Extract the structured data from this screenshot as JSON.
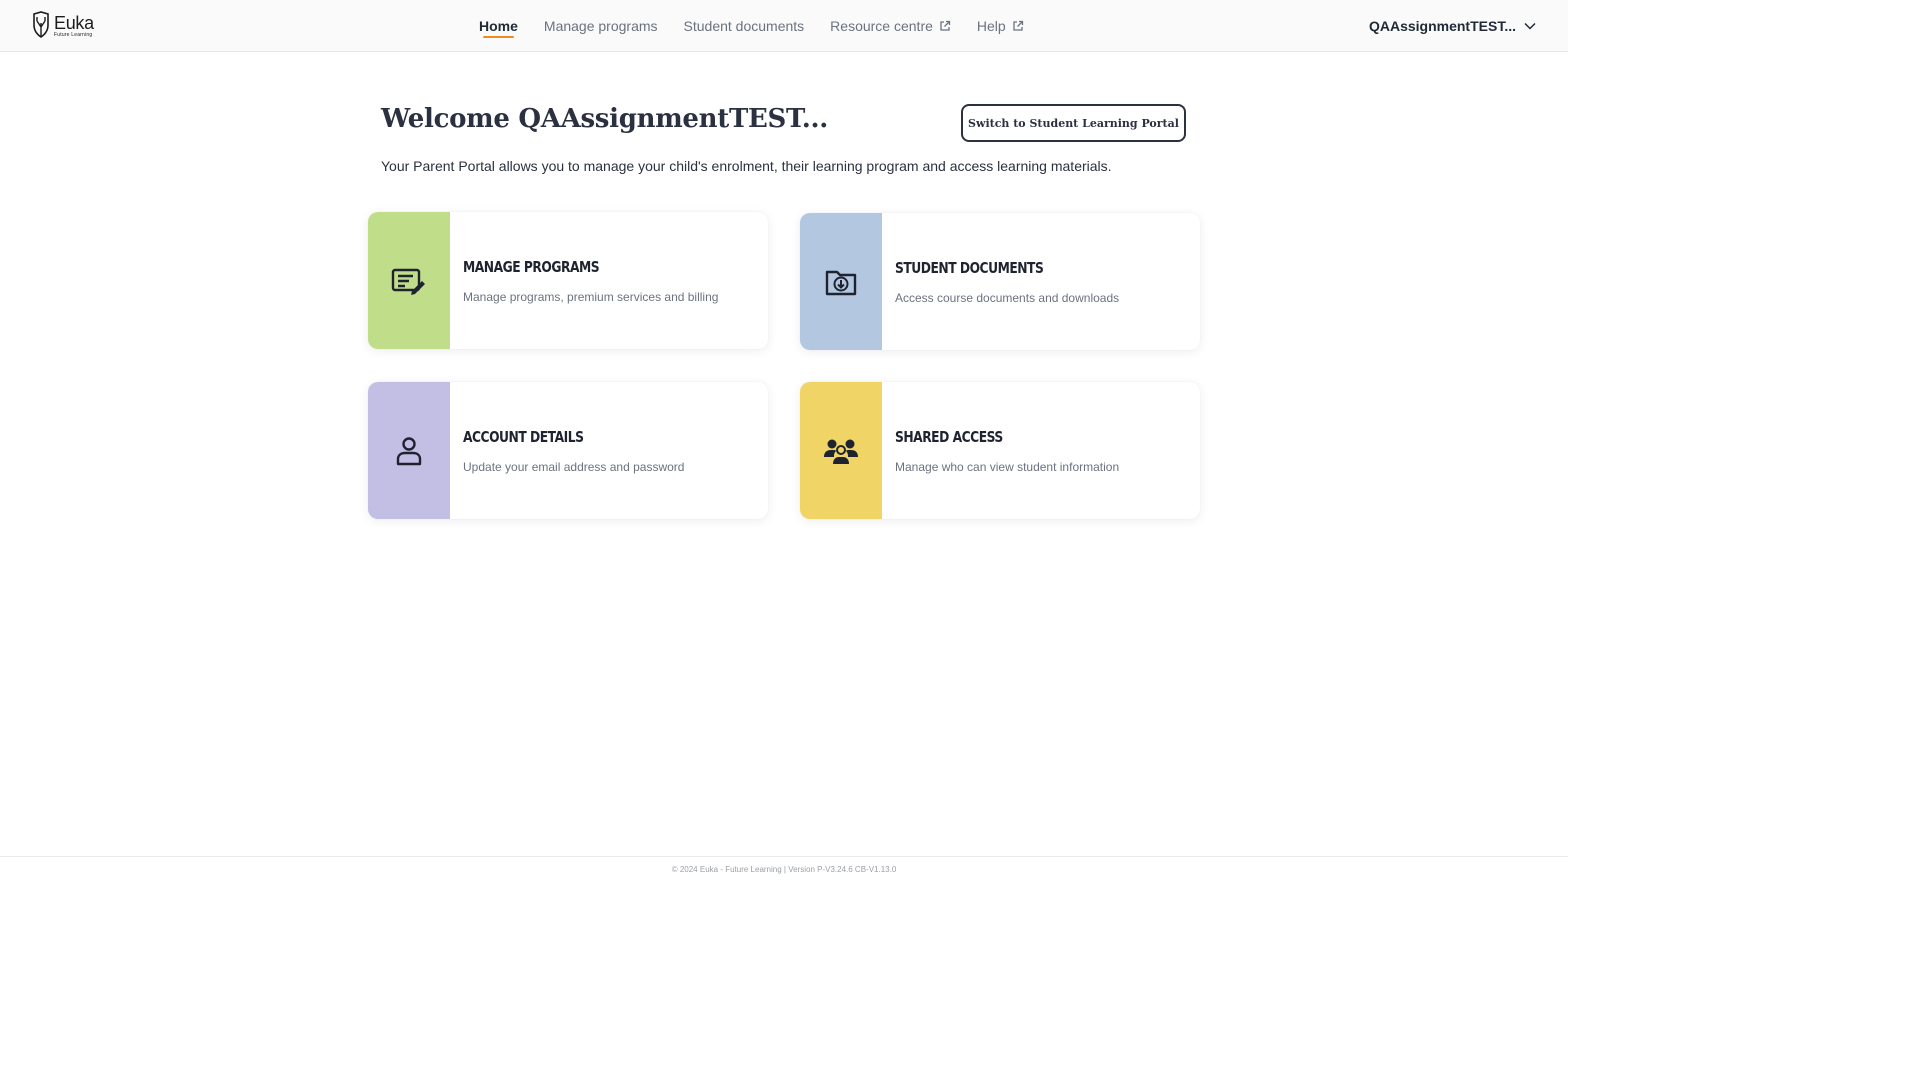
{
  "header": {
    "logo": {
      "name": "Euka",
      "tagline": "Future Learning"
    },
    "nav": [
      {
        "label": "Home",
        "active": true,
        "external": false
      },
      {
        "label": "Manage programs",
        "active": false,
        "external": false
      },
      {
        "label": "Student documents",
        "active": false,
        "external": false
      },
      {
        "label": "Resource centre",
        "active": false,
        "external": true
      },
      {
        "label": "Help",
        "active": false,
        "external": true
      }
    ],
    "user_menu": {
      "label": "QAAssignmentTEST...",
      "icon": "chevron-down-icon"
    }
  },
  "main": {
    "title": "Welcome QAAssignmentTEST...",
    "switch_button": "Switch to Student Learning Portal",
    "intro": "Your Parent Portal allows you to manage your child's enrolment, their learning program and access learning materials.",
    "cards": [
      {
        "title": "MANAGE PROGRAMS",
        "description": "Manage programs, premium services and billing",
        "color": "#c0de8a",
        "icon": "edit-document-icon"
      },
      {
        "title": "STUDENT DOCUMENTS",
        "description": "Access course documents and downloads",
        "color": "#b3c8e0",
        "icon": "folder-download-icon"
      },
      {
        "title": "ACCOUNT DETAILS",
        "description": "Update your email address and password",
        "color": "#c3bee3",
        "icon": "user-icon"
      },
      {
        "title": "SHARED ACCESS",
        "description": "Manage who can view student information",
        "color": "#f0d466",
        "icon": "group-icon"
      }
    ]
  },
  "footer": {
    "text": "© 2024 Euka - Future Learning | Version P-V3.24.6 CB-V1.13.0"
  },
  "colors": {
    "accent_underline": "#f08c1c",
    "progress": "#2f8fdd",
    "text_dark": "#2b3140"
  }
}
